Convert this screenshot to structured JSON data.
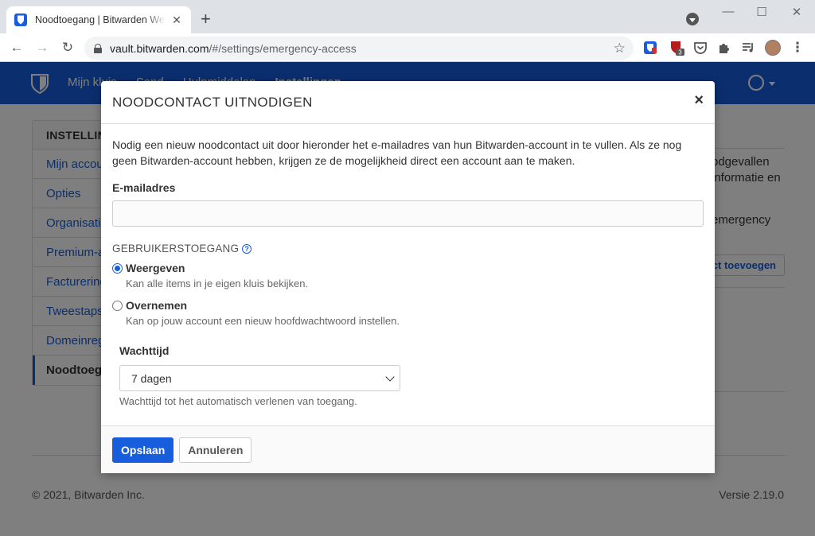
{
  "browser": {
    "tab_title": "Noodtoegang | Bitwarden Webkluis",
    "url_host": "vault.bitwarden.com",
    "url_path": "/#/settings/emergency-access",
    "extension_badge": "3",
    "icons": [
      "bitwarden-favicon-icon",
      "tab-close-icon",
      "new-tab-icon",
      "back-icon",
      "forward-icon",
      "reload-icon",
      "lock-icon",
      "bookmark-star-icon",
      "extensions-icon",
      "menu-icon"
    ]
  },
  "app": {
    "nav_links": [
      "Mijn kluis",
      "Send",
      "Hulpmiddelen",
      "Instellingen"
    ],
    "brand_color": "#175ddc"
  },
  "sidebar": {
    "heading": "INSTELLINGEN",
    "items": [
      {
        "label": "Mijn account"
      },
      {
        "label": "Opties"
      },
      {
        "label": "Organisaties"
      },
      {
        "label": "Premium-abonnement"
      },
      {
        "label": "Facturering"
      },
      {
        "label": "Tweestapsaanmelding"
      },
      {
        "label": "Domeinregels"
      },
      {
        "label": "Noodtoegang"
      }
    ]
  },
  "main": {
    "text_lines": [
      "odgevallen",
      "informatie en",
      "emergency"
    ],
    "add_button": "act toevoegen"
  },
  "footer": {
    "copyright": "© 2021, Bitwarden Inc.",
    "version": "Versie 2.19.0"
  },
  "modal": {
    "title": "NOODCONTACT UITNODIGEN",
    "close_glyph": "×",
    "intro": "Nodig een nieuw noodcontact uit door hieronder het e-mailadres van hun Bitwarden-account in te vullen. Als ze nog geen Bitwarden-account hebben, krijgen ze de mogelijkheid direct een account aan te maken.",
    "email_label": "E-mailadres",
    "email_value": "",
    "access_heading": "GEBRUIKERSTOEGANG",
    "help_glyph": "?",
    "options": [
      {
        "label": "Weergeven",
        "description": "Kan alle items in je eigen kluis bekijken.",
        "checked": true
      },
      {
        "label": "Overnemen",
        "description": "Kan op jouw account een nieuw hoofdwachtwoord instellen.",
        "checked": false
      }
    ],
    "wait_label": "Wachttijd",
    "wait_value": "7 dagen",
    "wait_hint": "Wachttijd tot het automatisch verlenen van toegang.",
    "save_button": "Opslaan",
    "cancel_button": "Annuleren"
  }
}
